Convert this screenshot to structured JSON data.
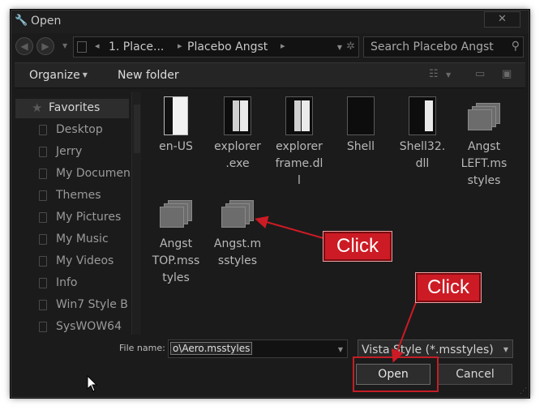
{
  "window": {
    "title": "Open",
    "close_label": "✕"
  },
  "nav": {
    "back_glyph": "◀",
    "forward_glyph": "▶",
    "crumbs": [
      "1. Place...",
      "Placebo Angst"
    ],
    "search_placeholder": "Search Placebo Angst"
  },
  "toolbar": {
    "organize": "Organize",
    "new_folder": "New folder"
  },
  "sidebar": {
    "favorites": "Favorites",
    "items": [
      {
        "label": "Desktop"
      },
      {
        "label": "Jerry"
      },
      {
        "label": "My Documen"
      },
      {
        "label": "Themes"
      },
      {
        "label": "My Pictures"
      },
      {
        "label": "My Music"
      },
      {
        "label": "My Videos"
      },
      {
        "label": "Info"
      },
      {
        "label": "Win7 Style B"
      },
      {
        "label": "SysWOW64"
      }
    ]
  },
  "files": [
    {
      "name_lines": [
        "en-US"
      ],
      "icon": "document-icon"
    },
    {
      "name_lines": [
        "explorer",
        ".exe"
      ],
      "icon": "application-icon"
    },
    {
      "name_lines": [
        "explorer",
        "frame.dl",
        "l"
      ],
      "icon": "application-icon"
    },
    {
      "name_lines": [
        "Shell"
      ],
      "icon": "folder-dark-icon"
    },
    {
      "name_lines": [
        "Shell32.",
        "dll"
      ],
      "icon": "dll-icon"
    },
    {
      "name_lines": [
        "Angst",
        "LEFT.ms",
        "styles"
      ],
      "icon": "msstyles-icon"
    },
    {
      "name_lines": [
        "Angst",
        "TOP.mss",
        "tyles"
      ],
      "icon": "msstyles-icon"
    },
    {
      "name_lines": [
        "Angst.m",
        "sstyles"
      ],
      "icon": "msstyles-icon"
    }
  ],
  "footer": {
    "file_name_label": "File name:",
    "file_name_value": "o\\Aero.msstyles",
    "filter_value": "Vista Style (*.msstyles)",
    "open_label": "Open",
    "cancel_label": "Cancel"
  },
  "annotations": {
    "callout_1": "Click",
    "callout_2": "Click",
    "color": "#cc1b24"
  }
}
